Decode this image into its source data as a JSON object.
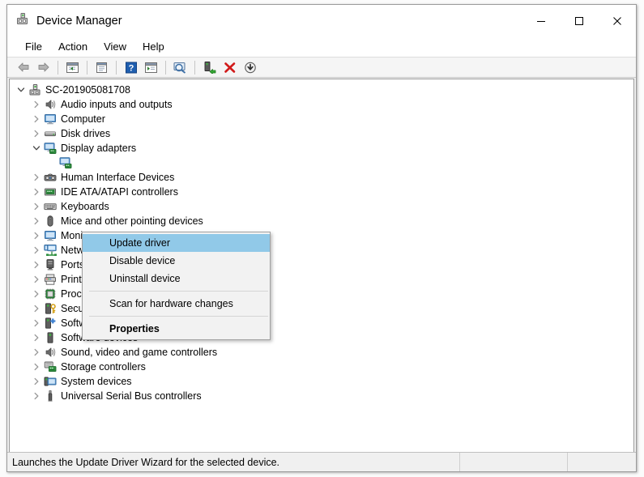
{
  "window": {
    "title": "Device Manager",
    "icon": "device-manager-icon",
    "controls": {
      "minimize": "─",
      "maximize": "□",
      "close": "✕"
    }
  },
  "menubar": {
    "items": [
      {
        "label": "File",
        "name": "menu-file"
      },
      {
        "label": "Action",
        "name": "menu-action"
      },
      {
        "label": "View",
        "name": "menu-view"
      },
      {
        "label": "Help",
        "name": "menu-help"
      }
    ]
  },
  "toolbar": {
    "buttons": [
      {
        "name": "back-button",
        "icon": "back-arrow-icon",
        "tooltip": "Back"
      },
      {
        "name": "forward-button",
        "icon": "forward-arrow-icon",
        "tooltip": "Forward"
      },
      {
        "name": "show-hide-console-tree-button",
        "icon": "console-tree-icon",
        "tooltip": "Show/Hide Console Tree"
      },
      {
        "name": "properties-button",
        "icon": "properties-icon",
        "tooltip": "Properties"
      },
      {
        "name": "help-button",
        "icon": "help-icon",
        "tooltip": "Help"
      },
      {
        "name": "view-button",
        "icon": "view-list-icon",
        "tooltip": "View"
      },
      {
        "name": "scan-hardware-button",
        "icon": "scan-hardware-icon",
        "tooltip": "Scan for hardware changes"
      },
      {
        "name": "update-driver-button",
        "icon": "update-driver-icon",
        "tooltip": "Update driver"
      },
      {
        "name": "uninstall-device-button",
        "icon": "uninstall-device-icon",
        "tooltip": "Uninstall device"
      },
      {
        "name": "disable-device-button",
        "icon": "disable-device-icon",
        "tooltip": "Disable device"
      }
    ]
  },
  "tree": {
    "root": {
      "label": "SC-201905081708",
      "icon": "computer-root-icon",
      "expanded": true
    },
    "items": [
      {
        "label": "Audio inputs and outputs",
        "icon": "speaker-icon",
        "expanded": false,
        "level": 1
      },
      {
        "label": "Computer",
        "icon": "monitor-icon",
        "expanded": false,
        "level": 1
      },
      {
        "label": "Disk drives",
        "icon": "disk-drive-icon",
        "expanded": false,
        "level": 1
      },
      {
        "label": "Display adapters",
        "icon": "display-adapter-icon",
        "expanded": true,
        "level": 1
      },
      {
        "label": "",
        "icon": "display-adapter-icon",
        "expanded": false,
        "level": 2,
        "selected": true
      },
      {
        "label": "Human Interface Devices",
        "icon": "hid-icon",
        "expanded": false,
        "level": 1
      },
      {
        "label": "IDE ATA/ATAPI controllers",
        "icon": "ide-controller-icon",
        "expanded": false,
        "level": 1
      },
      {
        "label": "Keyboards",
        "icon": "keyboard-icon",
        "expanded": false,
        "level": 1
      },
      {
        "label": "Mice and other pointing devices",
        "icon": "mouse-icon",
        "expanded": false,
        "level": 1
      },
      {
        "label": "Monitors",
        "icon": "monitor-icon",
        "expanded": false,
        "level": 1
      },
      {
        "label": "Network adapters",
        "icon": "network-adapter-icon",
        "expanded": false,
        "level": 1
      },
      {
        "label": "Ports (COM & LPT)",
        "icon": "port-icon",
        "expanded": false,
        "level": 1
      },
      {
        "label": "Print queues",
        "icon": "printer-icon",
        "expanded": false,
        "level": 1
      },
      {
        "label": "Processors",
        "icon": "processor-icon",
        "expanded": false,
        "level": 1
      },
      {
        "label": "Security devices",
        "icon": "security-device-icon",
        "expanded": false,
        "level": 1
      },
      {
        "label": "Software components",
        "icon": "software-component-icon",
        "expanded": false,
        "level": 1
      },
      {
        "label": "Software devices",
        "icon": "software-device-icon",
        "expanded": false,
        "level": 1
      },
      {
        "label": "Sound, video and game controllers",
        "icon": "speaker-icon",
        "expanded": false,
        "level": 1
      },
      {
        "label": "Storage controllers",
        "icon": "storage-controller-icon",
        "expanded": false,
        "level": 1
      },
      {
        "label": "System devices",
        "icon": "system-device-icon",
        "expanded": false,
        "level": 1
      },
      {
        "label": "Universal Serial Bus controllers",
        "icon": "usb-icon",
        "expanded": false,
        "level": 1
      }
    ]
  },
  "context_menu": {
    "items": [
      {
        "label": "Update driver",
        "selected": true,
        "bold": false,
        "name": "context-update-driver"
      },
      {
        "label": "Disable device",
        "selected": false,
        "bold": false,
        "name": "context-disable-device"
      },
      {
        "label": "Uninstall device",
        "selected": false,
        "bold": false,
        "name": "context-uninstall-device"
      },
      {
        "separator": true
      },
      {
        "label": "Scan for hardware changes",
        "selected": false,
        "bold": false,
        "name": "context-scan-hardware-changes"
      },
      {
        "separator": true
      },
      {
        "label": "Properties",
        "selected": false,
        "bold": true,
        "name": "context-properties"
      }
    ],
    "highlight_color": "#91c9e8"
  },
  "statusbar": {
    "message": "Launches the Update Driver Wizard for the selected device.",
    "panel2": "",
    "panel3": ""
  }
}
